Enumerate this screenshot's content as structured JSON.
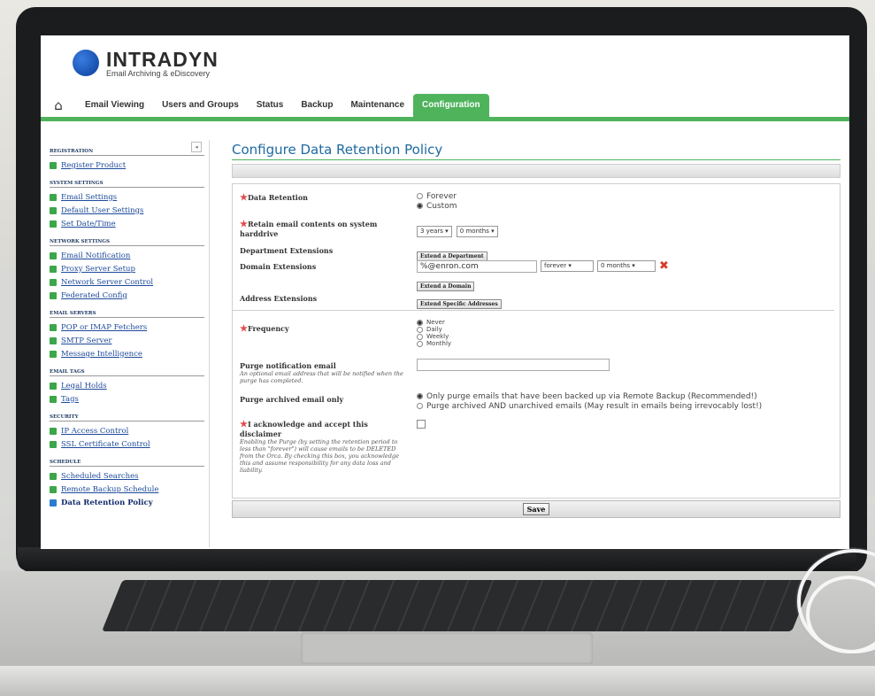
{
  "brand": {
    "name": "INTRADYN",
    "tagline": "Email Archiving & eDiscovery"
  },
  "nav": {
    "items": [
      "Email Viewing",
      "Users and Groups",
      "Status",
      "Backup",
      "Maintenance",
      "Configuration"
    ],
    "active": "Configuration"
  },
  "sidebar": {
    "collapse_glyph": "◂",
    "sections": [
      {
        "title": "REGISTRATION",
        "items": [
          "Register Product"
        ]
      },
      {
        "title": "SYSTEM SETTINGS",
        "items": [
          "Email Settings",
          "Default User Settings",
          "Set Date/Time"
        ]
      },
      {
        "title": "NETWORK SETTINGS",
        "items": [
          "Email Notification",
          "Proxy Server Setup",
          "Network Server Control",
          "Federated Config"
        ]
      },
      {
        "title": "EMAIL SERVERS",
        "items": [
          "POP or IMAP Fetchers",
          "SMTP Server",
          "Message Intelligence"
        ]
      },
      {
        "title": "EMAIL TAGS",
        "items": [
          "Legal Holds",
          "Tags"
        ]
      },
      {
        "title": "SECURITY",
        "items": [
          "IP Access Control",
          "SSL Certificate Control"
        ]
      },
      {
        "title": "SCHEDULE",
        "items": [
          "Scheduled Searches",
          "Remote Backup Schedule",
          "Data Retention Policy"
        ]
      }
    ]
  },
  "page": {
    "title": "Configure Data Retention Policy",
    "data_retention": {
      "label": "Data Retention",
      "options": [
        "Forever",
        "Custom"
      ],
      "selected": "Custom"
    },
    "retain": {
      "label": "Retain email contents on system harddrive",
      "years": "3 years",
      "months": "0 months"
    },
    "department": {
      "label": "Department Extensions",
      "button": "Extend a Department"
    },
    "domain": {
      "label": "Domain Extensions",
      "value": "%@enron.com",
      "period": "forever",
      "months": "0 months",
      "button": "Extend a Domain",
      "remove_glyph": "✖"
    },
    "address": {
      "label": "Address Extensions",
      "button": "Extend Specific Addresses"
    },
    "frequency": {
      "label": "Frequency",
      "options": [
        "Never",
        "Daily",
        "Weekly",
        "Monthly"
      ],
      "selected": "Never"
    },
    "purge_email": {
      "label": "Purge notification email",
      "help": "An optional email address that will be notified when the purge has completed.",
      "value": ""
    },
    "purge_archived": {
      "label": "Purge archived email only",
      "options": [
        "Only purge emails that have been backed up via Remote Backup (Recommended!)",
        "Purge archived AND unarchived emails (May result in emails being irrevocably lost!)"
      ],
      "selected": 0
    },
    "disclaimer": {
      "label": "I acknowledge and accept this disclaimer",
      "help": "Enabling the Purge (by setting the retention period to less than \"forever\") will cause emails to be DELETED from the Orca. By checking this box, you acknowledge this and assume responsibility for any data loss and liability.",
      "checked": false
    },
    "save_label": "Save",
    "required_glyph": "★"
  }
}
